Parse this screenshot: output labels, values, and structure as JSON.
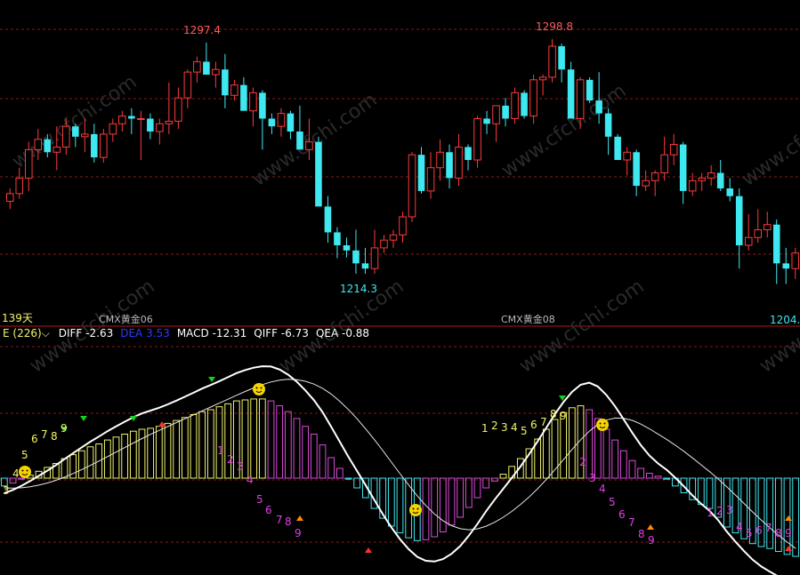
{
  "colors": {
    "background": "#000000",
    "grid": "#8a1a1a",
    "candle_up": "#ff3a3a",
    "candle_down": "#3ee8f0",
    "macd_pos": "#f3f36b",
    "macd_neg_fade": "#d94bd9",
    "macd_neg": "#3ee8f0",
    "diff_line": "#ffffff",
    "dea_line": "#e6e6e6",
    "high_label": "#ff5a5a",
    "low_label": "#3ee8f0",
    "count_yellow": "#f3f36b",
    "count_magenta": "#e040e0",
    "arrow_green": "#19d119",
    "arrow_red": "#ff3030",
    "arrow_orange": "#ff8c00",
    "smiley": "#f5d400"
  },
  "watermark": "www.cfchi.com",
  "price_panel": {
    "high_label_1": "1297.4",
    "high_label_2": "1298.8",
    "low_label_1": "1214.3",
    "low_label_2": "1204.",
    "period_label": "139天",
    "contract_label_1": "CMX黄金06",
    "contract_label_2": "CMX黄金08"
  },
  "indicator_header": {
    "name": "E (226)",
    "dropdown_icon": "chevron-down-icon",
    "diff": "DIFF -2.63",
    "dea": "DEA 3.53",
    "macd": "MACD -12.31",
    "qiff": "QIFF -6.73",
    "qea": "QEA -0.88"
  },
  "chart_data": [
    {
      "type": "candlestick",
      "title": "",
      "y_axis_range_approx": [
        1197,
        1307
      ],
      "annotated_extremes": [
        {
          "label": "1297.4",
          "kind": "high"
        },
        {
          "label": "1298.8",
          "kind": "high"
        },
        {
          "label": "1214.3",
          "kind": "low"
        },
        {
          "label": "1204.",
          "kind": "low"
        }
      ],
      "candles": [
        [
          1236,
          1241,
          1233,
          1239
        ],
        [
          1239,
          1249,
          1237,
          1245
        ],
        [
          1245,
          1259,
          1240,
          1256
        ],
        [
          1256,
          1264,
          1252,
          1260
        ],
        [
          1260,
          1262,
          1253,
          1255
        ],
        [
          1255,
          1265,
          1248,
          1257
        ],
        [
          1257,
          1268,
          1254,
          1265
        ],
        [
          1265,
          1266,
          1257,
          1261
        ],
        [
          1261,
          1268,
          1255,
          1262
        ],
        [
          1262,
          1266,
          1251,
          1253
        ],
        [
          1253,
          1264,
          1251,
          1262
        ],
        [
          1262,
          1268,
          1259,
          1266
        ],
        [
          1266,
          1271,
          1263,
          1269
        ],
        [
          1269,
          1272,
          1262,
          1268
        ],
        [
          1268,
          1271,
          1252,
          1268
        ],
        [
          1268,
          1270,
          1260,
          1263
        ],
        [
          1263,
          1268,
          1258,
          1266
        ],
        [
          1266,
          1282,
          1262,
          1267
        ],
        [
          1267,
          1280,
          1264,
          1276
        ],
        [
          1276,
          1287,
          1272,
          1286
        ],
        [
          1286,
          1292,
          1282,
          1290
        ],
        [
          1290,
          1297.4,
          1285,
          1285
        ],
        [
          1285,
          1290,
          1280,
          1287
        ],
        [
          1287,
          1293,
          1272,
          1277
        ],
        [
          1277,
          1283,
          1275,
          1281
        ],
        [
          1281,
          1284,
          1272,
          1271
        ],
        [
          1271,
          1280,
          1265,
          1278
        ],
        [
          1278,
          1279,
          1256,
          1268
        ],
        [
          1268,
          1270,
          1262,
          1265
        ],
        [
          1265,
          1272,
          1261,
          1270
        ],
        [
          1270,
          1271,
          1260,
          1263
        ],
        [
          1263,
          1273,
          1258,
          1256
        ],
        [
          1256,
          1268,
          1252,
          1259
        ],
        [
          1259,
          1261,
          1236,
          1234
        ],
        [
          1234,
          1238,
          1220,
          1224
        ],
        [
          1224,
          1226,
          1214,
          1219
        ],
        [
          1219,
          1222,
          1214.3,
          1217
        ],
        [
          1217,
          1225,
          1208,
          1212
        ],
        [
          1212,
          1218,
          1208,
          1210
        ],
        [
          1210,
          1225,
          1208,
          1218
        ],
        [
          1218,
          1223,
          1216,
          1221
        ],
        [
          1221,
          1225,
          1218,
          1223
        ],
        [
          1223,
          1232,
          1220,
          1230
        ],
        [
          1230,
          1255,
          1228,
          1254
        ],
        [
          1254,
          1257,
          1239,
          1240
        ],
        [
          1240,
          1255,
          1237,
          1249
        ],
        [
          1249,
          1260,
          1244,
          1255
        ],
        [
          1255,
          1258,
          1241,
          1245
        ],
        [
          1245,
          1262,
          1242,
          1257
        ],
        [
          1257,
          1258,
          1248,
          1252
        ],
        [
          1252,
          1269,
          1249,
          1268
        ],
        [
          1268,
          1271,
          1262,
          1266
        ],
        [
          1266,
          1273,
          1259,
          1273
        ],
        [
          1273,
          1276,
          1265,
          1268
        ],
        [
          1268,
          1280,
          1266,
          1278
        ],
        [
          1278,
          1279,
          1268,
          1269
        ],
        [
          1269,
          1285,
          1266,
          1283
        ],
        [
          1283,
          1285,
          1277,
          1284
        ],
        [
          1284,
          1298.8,
          1282,
          1296
        ],
        [
          1296,
          1297,
          1282,
          1287
        ],
        [
          1287,
          1290,
          1268,
          1268
        ],
        [
          1268,
          1284,
          1264,
          1283
        ],
        [
          1283,
          1284,
          1274,
          1275
        ],
        [
          1275,
          1286,
          1266,
          1270
        ],
        [
          1270,
          1272,
          1254,
          1261
        ],
        [
          1261,
          1262,
          1254,
          1252
        ],
        [
          1252,
          1257,
          1246,
          1255
        ],
        [
          1255,
          1256,
          1238,
          1242
        ],
        [
          1242,
          1248,
          1240,
          1244
        ],
        [
          1244,
          1248,
          1238,
          1247
        ],
        [
          1247,
          1261,
          1244,
          1254
        ],
        [
          1254,
          1262,
          1250,
          1258
        ],
        [
          1258,
          1259,
          1235,
          1240
        ],
        [
          1240,
          1247,
          1238,
          1244
        ],
        [
          1244,
          1247,
          1240,
          1245
        ],
        [
          1245,
          1250,
          1242,
          1247
        ],
        [
          1247,
          1252,
          1240,
          1241
        ],
        [
          1241,
          1245,
          1236,
          1238
        ],
        [
          1238,
          1241,
          1210,
          1219
        ],
        [
          1219,
          1231,
          1217,
          1222
        ],
        [
          1222,
          1233,
          1220,
          1225
        ],
        [
          1225,
          1232,
          1222,
          1227
        ],
        [
          1227,
          1229,
          1204,
          1212
        ],
        [
          1212,
          1218,
          1204,
          1210
        ],
        [
          1210,
          1218,
          1206,
          1216
        ]
      ]
    },
    {
      "type": "bar",
      "title": "",
      "xlabel": "",
      "ylabel": "",
      "ylim": [
        -17,
        13
      ],
      "series": [
        {
          "name": "MACD",
          "values": [
            -0.8,
            -0.5,
            -0.1,
            0.3,
            0.7,
            1.1,
            1.5,
            2.0,
            2.4,
            2.8,
            3.2,
            3.5,
            3.9,
            4.2,
            4.5,
            4.8,
            5.0,
            5.1,
            5.3,
            5.6,
            5.9,
            6.2,
            6.5,
            6.8,
            7.0,
            7.3,
            7.6,
            7.9,
            8.0,
            8.1,
            8.1,
            7.9,
            7.4,
            6.8,
            6.1,
            5.3,
            4.5,
            3.4,
            2.1,
            1.0,
            -0.1,
            -1.0,
            -2.0,
            -3.1,
            -4.1,
            -4.9,
            -5.6,
            -6.1,
            -6.4,
            -6.3,
            -6.0,
            -5.5,
            -4.8,
            -4.0,
            -3.0,
            -2.0,
            -1.0,
            -0.3,
            0.4,
            1.2,
            2.0,
            3.0,
            4.0,
            5.0,
            6.0,
            6.7,
            7.2,
            7.4,
            7.0,
            6.1,
            5.0,
            3.9,
            2.8,
            1.8,
            1.0,
            0.5,
            0.2,
            -0.1,
            -0.8,
            -1.5,
            -2.2,
            -2.7,
            -3.1,
            -4.0,
            -5.0,
            -5.6,
            -6.2,
            -6.7,
            -7.0,
            -7.2,
            -7.5,
            -7.8,
            -8.0
          ]
        },
        {
          "name": "DIFF",
          "values": []
        },
        {
          "name": "DEA",
          "values": []
        }
      ],
      "signals": {
        "smiley_faces": 5,
        "count_sequences": [
          "3 4 5 6 7 8 9",
          "1 2 3 4 5 6 7 8 9",
          "1 2 3",
          "4 5 6 7 8 9",
          "1 2 3 4 5 6 7 8 9",
          "1 2",
          "3 4 5 6 7 8 9",
          "1 2 3 4 5 6 7 8 9"
        ]
      }
    }
  ]
}
